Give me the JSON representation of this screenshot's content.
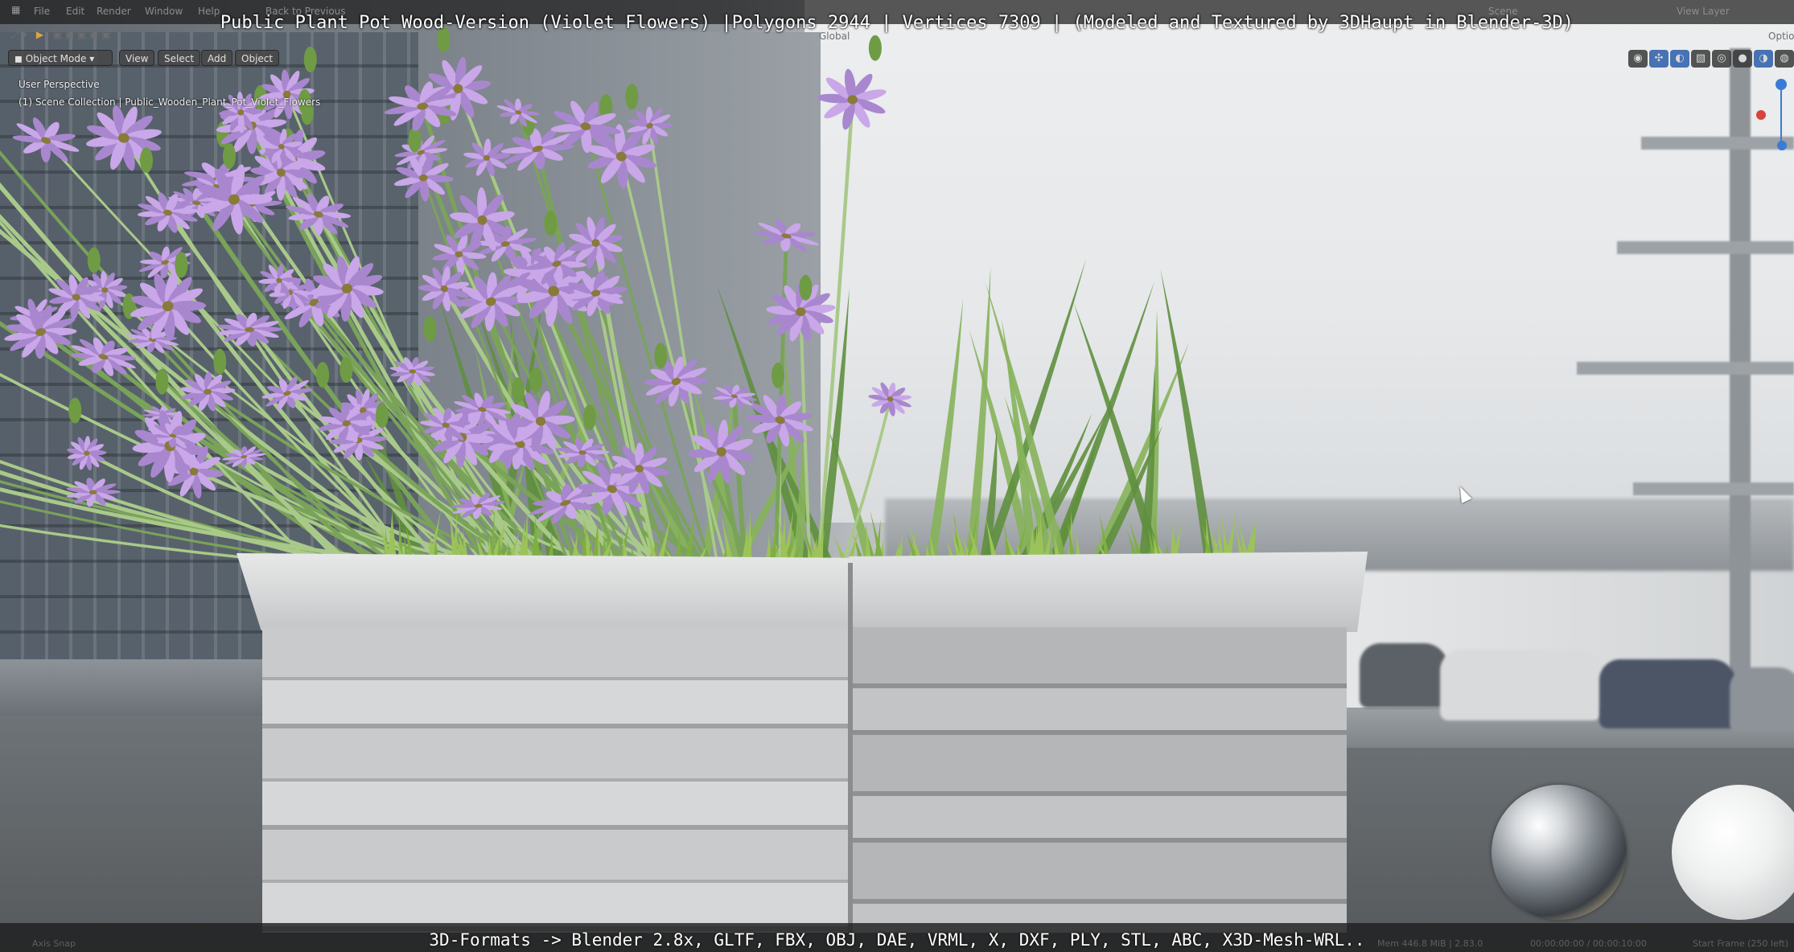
{
  "window": {
    "title_overlay": "Public Plant Pot Wood-Version (Violet Flowers) |Polygons 2944 | Vertices 7309 | (Modeled and Textured by 3DHaupt in Blender-3D)",
    "bottom_overlay": "3D-Formats -> Blender 2.8x, GLTF, FBX, OBJ, DAE, VRML, X, DXF, PLY, STL, ABC, X3D-Mesh-WRL.."
  },
  "topbar": {
    "menus": [
      "File",
      "Edit",
      "Render",
      "Window",
      "Help"
    ],
    "back_to_previous": "Back to Previous",
    "scene_label": "Scene",
    "view_layer_label": "View Layer",
    "orientation": "Global",
    "options": "Optio"
  },
  "viewport_header": {
    "mode": "Object Mode",
    "menus": [
      "View",
      "Select",
      "Add",
      "Object"
    ]
  },
  "viewport": {
    "perspective": "User Perspective",
    "collection": "(1) Scene Collection | Public_Wooden_Plant_Pot_Violet_Flowers"
  },
  "icons": {
    "editor_type": "editor-type-icon",
    "play": "play-icon",
    "visibility": "visibility-icon",
    "gizmo": "gizmo-icon",
    "overlay": "overlay-icon",
    "wireframe": "wireframe-shading-icon",
    "solid": "solid-shading-icon",
    "material": "material-shading-icon",
    "rendered": "rendered-shading-icon"
  },
  "status": {
    "left": "Axis Snap",
    "mem": "Mem 446.8 MiB | 2.83.0",
    "frames": "00:00:00:00 / 00:00:10:00",
    "start": "Start Frame (250 left)"
  },
  "colors": {
    "accent": "#4772b3",
    "petal": "#c9a7e8",
    "petal_dark": "#a987cf",
    "stem": "#7aa35a",
    "grass": "#9cc35a"
  }
}
